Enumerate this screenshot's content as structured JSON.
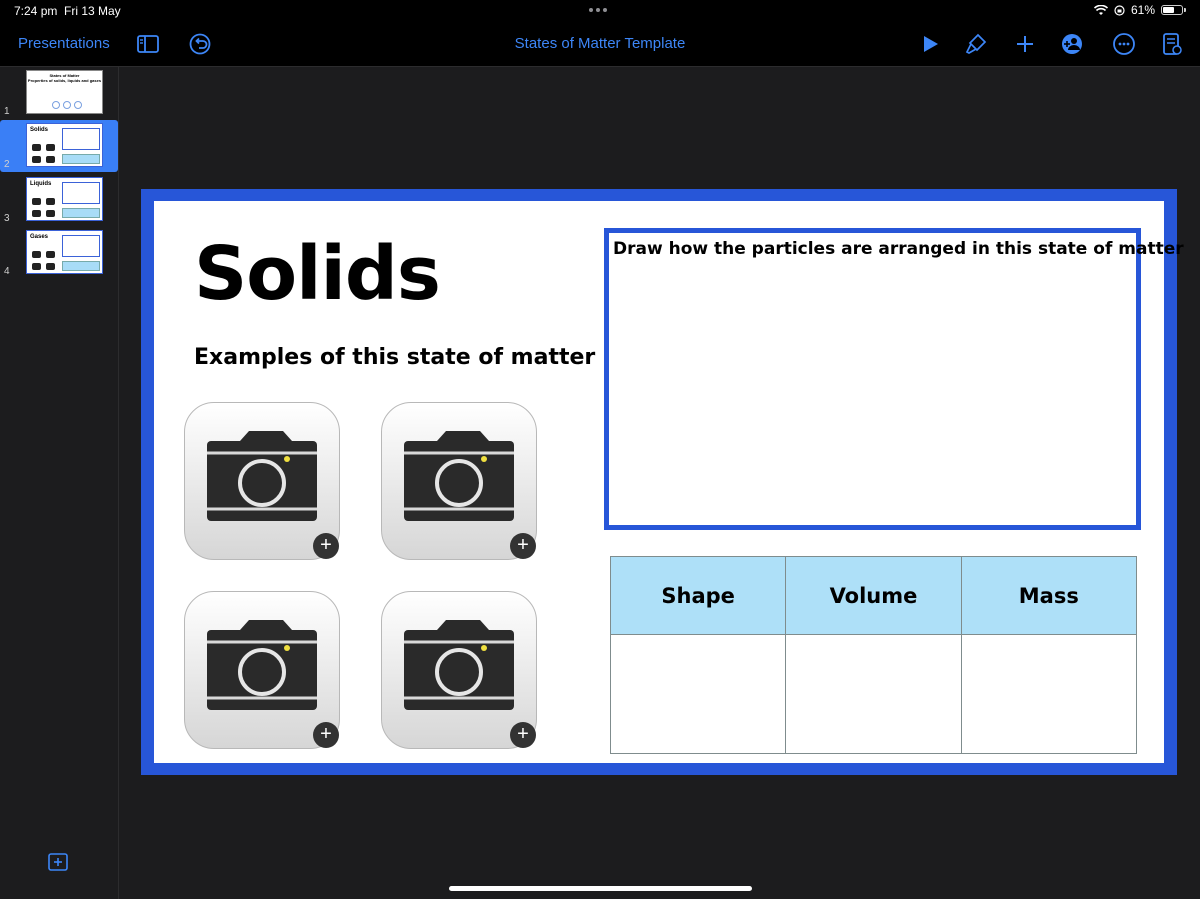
{
  "status": {
    "time": "7:24 pm",
    "date": "Fri 13 May",
    "battery": "61%",
    "battery_level": 0.61
  },
  "toolbar": {
    "back_label": "Presentations",
    "title": "States of Matter Template"
  },
  "sidebar": {
    "slides": [
      {
        "num": "1",
        "title": "States of Matter",
        "subtitle": "Properties of solids, liquids and gases"
      },
      {
        "num": "2",
        "title": "Solids",
        "selected": true
      },
      {
        "num": "3",
        "title": "Liquids"
      },
      {
        "num": "4",
        "title": "Gases"
      }
    ]
  },
  "slide": {
    "title": "Solids",
    "subtitle": "Examples of this state of matter",
    "draw_prompt": "Draw how the particles are arranged in this state of matter",
    "table_headers": [
      "Shape",
      "Volume",
      "Mass"
    ],
    "photo_add_symbol": "+"
  },
  "colors": {
    "accent": "#3d86f7",
    "slide_border": "#2756d8",
    "table_header": "#aee0f8"
  }
}
